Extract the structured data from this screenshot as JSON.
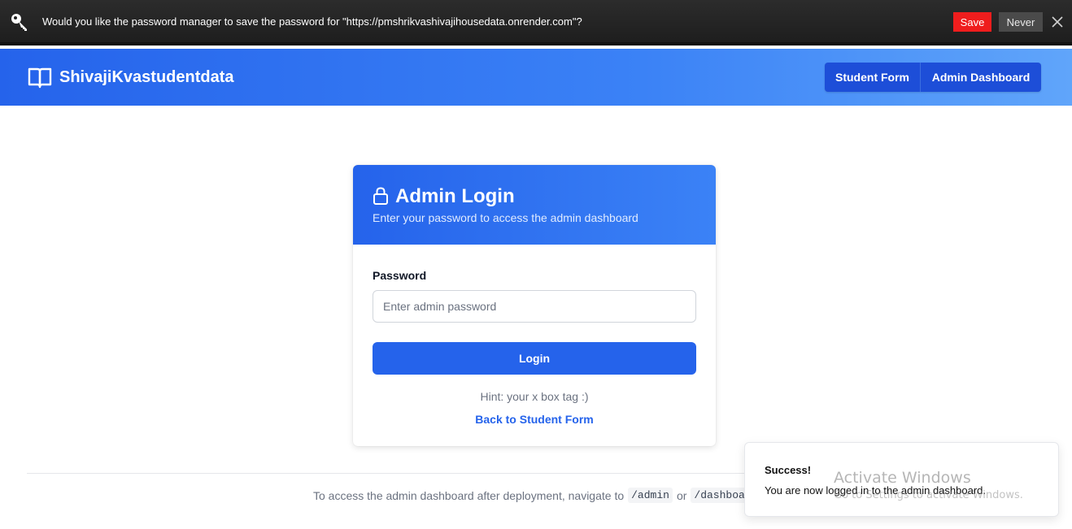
{
  "password_prompt": {
    "message": "Would you like the password manager to save the password for \"https://pmshrikvashivajihousedata.onrender.com\"?",
    "save_label": "Save",
    "never_label": "Never",
    "colors": {
      "save": "#ef1d1d",
      "never": "#4a4a4a"
    },
    "icons": {
      "key": "key-icon",
      "close": "close-icon"
    }
  },
  "header": {
    "brand": "ShivajiKvastudentdata",
    "brand_icon": "book-open-icon",
    "nav": [
      {
        "label": "Student Form"
      },
      {
        "label": "Admin Dashboard"
      }
    ],
    "colors": {
      "accent": "#2563eb",
      "nav_bg": "#1d4ed8"
    }
  },
  "login_card": {
    "title": "Admin Login",
    "title_icon": "lock-icon",
    "subtitle": "Enter your password to access the admin dashboard",
    "password_label": "Password",
    "password_placeholder": "Enter admin password",
    "password_value": "",
    "login_label": "Login",
    "hint": "Hint: your x box tag :)",
    "back_link": "Back to Student Form"
  },
  "footer": {
    "text_before": "To access the admin dashboard after deployment, navigate to",
    "code1": "/admin",
    "text_or": "or",
    "code2": "/dashboard"
  },
  "toast": {
    "title": "Success!",
    "message": "You are now logged in to the admin dashboard."
  },
  "watermark": {
    "title": "Activate Windows",
    "subtitle": "Go to Settings to activate Windows."
  }
}
